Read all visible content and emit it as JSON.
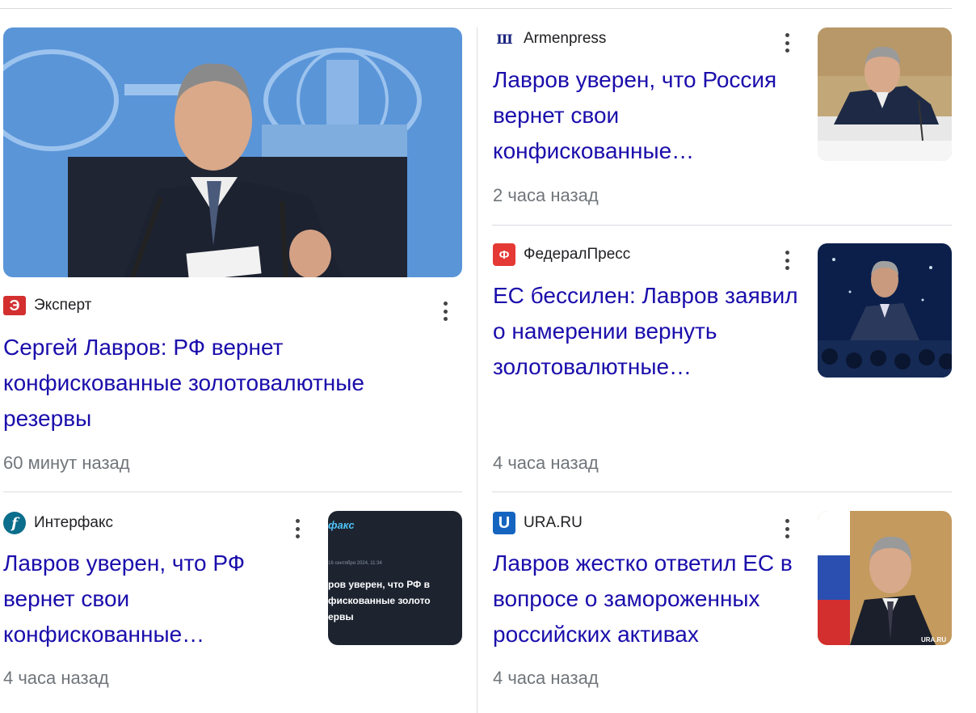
{
  "articles": [
    {
      "source": "Эксперт",
      "favicon_letter": "Э",
      "title": "Сергей Лавров: РФ вернет конфискованные золотовалютные резервы",
      "time": "60 минут назад",
      "image": "lavrov-press-conference-photo"
    },
    {
      "source": "Armenpress",
      "favicon_letter": "Ш",
      "title": "Лавров уверен, что Россия вернет свои конфискованные…",
      "time": "2 часа назад",
      "image": "lavrov-at-table-photo"
    },
    {
      "source": "ФедералПресс",
      "favicon_letter": "Ф",
      "title": "ЕС бессилен: Лавров заявил о намерении вернуть золотовалютные…",
      "time": "4 часа назад",
      "image": "lavrov-on-stage-photo"
    },
    {
      "source": "Интерфакс",
      "favicon_letter": "f",
      "title": "Лавров уверен, что РФ вернет свои конфискованные…",
      "time": "4 часа назад",
      "image": "interfax-headline-screenshot",
      "thumb_text": {
        "logo": "факс",
        "date": "16 сентября 2024, 11:34",
        "line1": "ров уверен, что РФ в",
        "line2": "фискованные золото",
        "line3": "ервы"
      }
    },
    {
      "source": "URA.RU",
      "favicon_letter": "U",
      "title": "Лавров жестко ответил ЕС в вопросе о замороженных российских активах",
      "time": "4 часа назад",
      "image": "lavrov-with-flag-photo",
      "thumb_text": {
        "watermark": "URA.RU"
      }
    }
  ],
  "colors": {
    "link": "#1a0dab",
    "meta": "#70757a",
    "divider": "#dadce0",
    "expert_red": "#d32f2f",
    "armenpress_blue": "#1a237e",
    "federalpress_red": "#e53935",
    "interfax_blue": "#0b6e8c",
    "ura_blue": "#1565c0"
  }
}
